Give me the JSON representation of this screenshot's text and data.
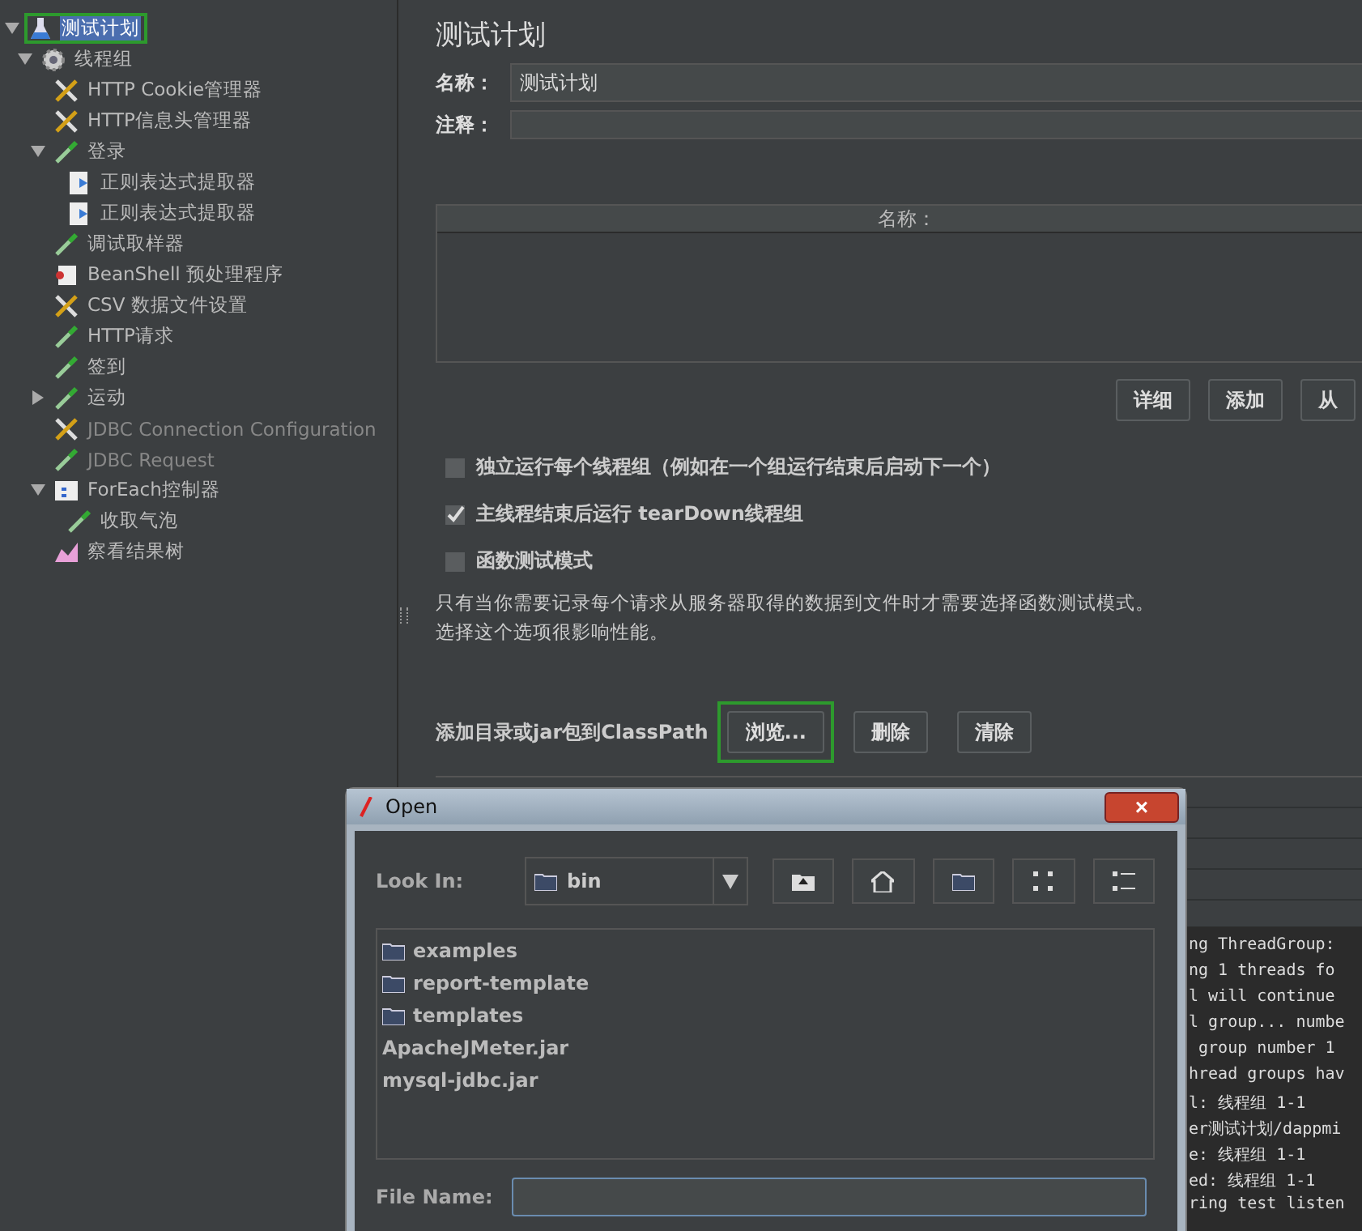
{
  "tree": [
    {
      "label": "测试计划",
      "kind": "plan",
      "selected": true,
      "disabled": false,
      "outlined": true,
      "expanded": true,
      "children": [
        {
          "label": "线程组",
          "kind": "threads",
          "selected": false,
          "disabled": false,
          "outlined": false,
          "expanded": true,
          "children": [
            {
              "label": "HTTP Cookie管理器",
              "kind": "config",
              "selected": false,
              "disabled": false,
              "outlined": false
            },
            {
              "label": "HTTP信息头管理器",
              "kind": "config",
              "selected": false,
              "disabled": false,
              "outlined": false
            },
            {
              "label": "登录",
              "kind": "sampler",
              "selected": false,
              "disabled": false,
              "outlined": false,
              "expanded": true,
              "children": [
                {
                  "label": "正则表达式提取器",
                  "kind": "extractor",
                  "selected": false,
                  "disabled": false,
                  "outlined": false
                },
                {
                  "label": "正则表达式提取器",
                  "kind": "extractor",
                  "selected": false,
                  "disabled": false,
                  "outlined": false
                }
              ]
            },
            {
              "label": "调试取样器",
              "kind": "sampler",
              "selected": false,
              "disabled": false,
              "outlined": false
            },
            {
              "label": "BeanShell 预处理程序",
              "kind": "script",
              "selected": false,
              "disabled": false,
              "outlined": false
            },
            {
              "label": "CSV 数据文件设置",
              "kind": "config",
              "selected": false,
              "disabled": false,
              "outlined": false
            },
            {
              "label": "HTTP请求",
              "kind": "sampler",
              "selected": false,
              "disabled": false,
              "outlined": false
            },
            {
              "label": "签到",
              "kind": "sampler",
              "selected": false,
              "disabled": false,
              "outlined": false
            },
            {
              "label": "运动",
              "kind": "sampler",
              "selected": false,
              "disabled": false,
              "outlined": false,
              "expanded": false
            },
            {
              "label": "JDBC Connection Configuration",
              "kind": "config",
              "selected": false,
              "disabled": true,
              "outlined": false
            },
            {
              "label": "JDBC Request",
              "kind": "sampler",
              "selected": false,
              "disabled": true,
              "outlined": false
            },
            {
              "label": "ForEach控制器",
              "kind": "controller",
              "selected": false,
              "disabled": false,
              "outlined": false,
              "expanded": true,
              "children": [
                {
                  "label": "收取气泡",
                  "kind": "sampler",
                  "selected": false,
                  "disabled": false,
                  "outlined": false
                }
              ]
            },
            {
              "label": "察看结果树",
              "kind": "listener",
              "selected": false,
              "disabled": false,
              "outlined": false
            }
          ]
        }
      ]
    }
  ],
  "panel": {
    "title": "测试计划",
    "name_label": "名称：",
    "name_value": "测试计划",
    "comment_label": "注释：",
    "table": {
      "columns": [
        "名称："
      ]
    },
    "table_buttons": [
      "详细",
      "添加",
      "从"
    ],
    "options": [
      {
        "label": "独立运行每个线程组（例如在一个组运行结束后启动下一个）",
        "checked": false
      },
      {
        "label": "主线程结束后运行 tearDown线程组",
        "checked": true
      },
      {
        "label": "函数测试模式",
        "checked": false
      }
    ],
    "note": [
      "只有当你需要记录每个请求从服务器取得的数据到文件时才需要选择函数测试模式。",
      "选择这个选项很影响性能。"
    ],
    "classpath_label": "添加目录或jar包到ClassPath",
    "classpath_buttons": [
      {
        "label": "浏览...",
        "outlined": true
      },
      {
        "label": "删除",
        "outlined": false
      },
      {
        "label": "清除",
        "outlined": false
      }
    ],
    "log": [
      "ng ThreadGroup:",
      "ng 1 threads fo",
      "l will continue",
      "l group... numbe",
      " group number 1",
      "hread groups hav",
      "l: 线程组 1-1",
      "er测试计划/dappmi",
      "e: 线程组 1-1",
      "ed: 线程组 1-1",
      "ring test listen"
    ]
  },
  "dialog": {
    "title": "Open",
    "look_in_label": "Look In:",
    "look_in_value": "bin",
    "files": [
      {
        "name": "examples",
        "kind": "folder"
      },
      {
        "name": "report-template",
        "kind": "folder"
      },
      {
        "name": "templates",
        "kind": "folder"
      },
      {
        "name": "ApacheJMeter.jar",
        "kind": "file"
      },
      {
        "name": "mysql-jdbc.jar",
        "kind": "file"
      }
    ],
    "file_name_label": "File Name:",
    "close_label": "×"
  }
}
